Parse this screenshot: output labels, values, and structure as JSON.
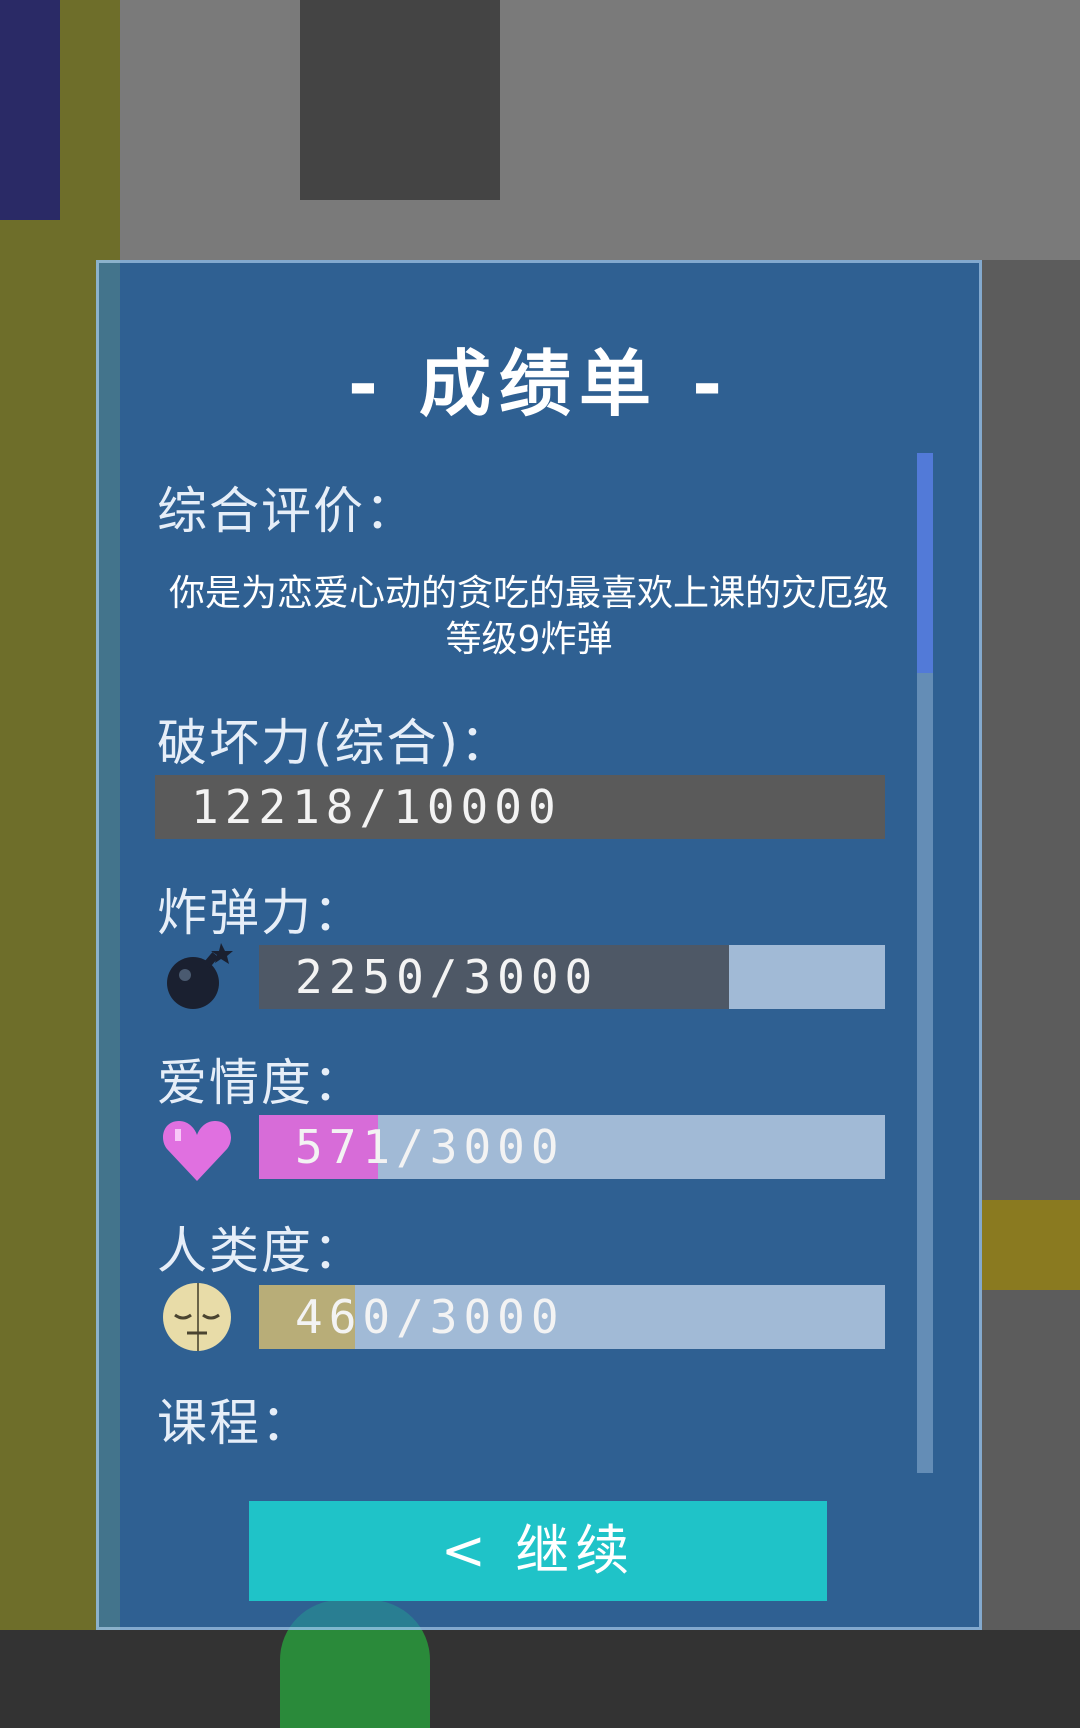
{
  "report": {
    "title": "- 成绩单 -",
    "overall_label": "综合评价：",
    "overall_text": "你是为恋爱心动的贪吃的最喜欢上课的灾厄级等级9炸弹",
    "destruction": {
      "label": "破坏力(综合)：",
      "value_text": "12218/10000",
      "value": 12218,
      "max": 10000,
      "fill_color": "#5a5a5a"
    },
    "bomb": {
      "label": "炸弹力：",
      "value_text": "2250/3000",
      "value": 2250,
      "max": 3000,
      "icon": "bomb-icon",
      "fill_color": "#4e5866"
    },
    "love": {
      "label": "爱情度：",
      "value_text": "571/3000",
      "value": 571,
      "max": 3000,
      "icon": "heart-icon",
      "fill_color": "#d76cd8"
    },
    "humanity": {
      "label": "人类度：",
      "value_text": "460/3000",
      "value": 460,
      "max": 3000,
      "icon": "face-icon",
      "fill_color": "#b8ad78"
    },
    "courses_label": "课程：",
    "continue_label": "< 继续"
  },
  "colors": {
    "panel": "#2878c8",
    "button": "#1fc3c8",
    "text": "#ffffff"
  }
}
